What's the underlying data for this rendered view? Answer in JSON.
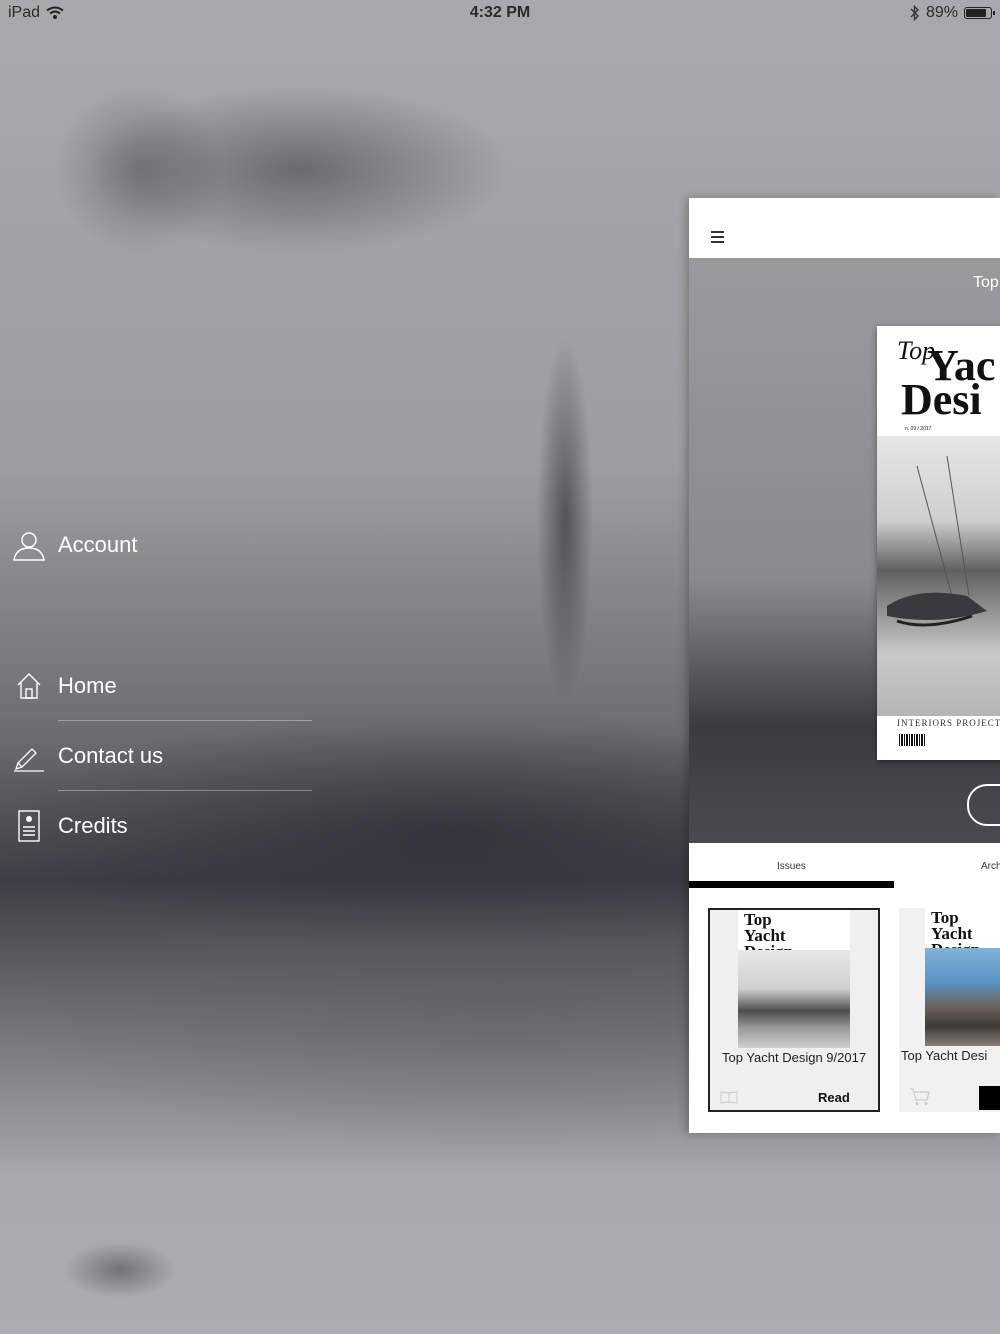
{
  "status_bar": {
    "device": "iPad",
    "time": "4:32 PM",
    "battery_percent": "89%",
    "battery_level": 0.89
  },
  "side_menu": {
    "account": "Account",
    "items": [
      {
        "label": "Home",
        "icon": "home-icon"
      },
      {
        "label": "Contact us",
        "icon": "pen-icon"
      },
      {
        "label": "Credits",
        "icon": "credits-icon"
      }
    ]
  },
  "app": {
    "hero_title": "Top",
    "cover": {
      "mast_top": "Top",
      "mast_word1": "Yac",
      "mast_word2": "Desi",
      "issue": "n. 09 / 2017",
      "tagline": "INTERIORS  PROJECTS  TR"
    },
    "tabs": [
      {
        "label": "Issues",
        "active": true
      },
      {
        "label": "Arch",
        "active": false
      }
    ],
    "issues": [
      {
        "title": "Top Yacht Design 9/2017",
        "action": "Read",
        "thumb_mast": "Top Yacht Design"
      },
      {
        "title": "Top Yacht Desi",
        "action": "",
        "thumb_mast": "Top Yacht Design"
      }
    ]
  },
  "colors": {
    "menu_text": "#ffffff",
    "panel_bg": "#ffffff",
    "tab_underline": "#000000"
  }
}
